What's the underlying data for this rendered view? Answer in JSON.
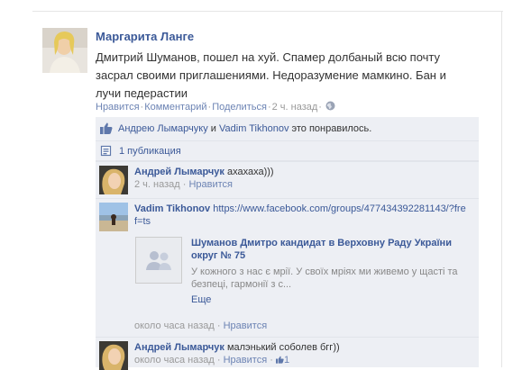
{
  "post": {
    "author": "Маргарита Ланге",
    "text": "Дмитрий Шуманов, пошел на хуй. Спамер долбаный всю почту засрал своими приглашениями. Недоразумение мамкино. Бан и лучи педерастии",
    "actions": {
      "like": "Нравится",
      "comment": "Комментарий",
      "share": "Поделиться",
      "time": "2 ч. назад"
    }
  },
  "likes": {
    "user1": "Андрею Лымарчуку",
    "conj": " и ",
    "user2": "Vadim Tikhonov",
    "suffix": " это понравилось."
  },
  "shares": {
    "label": "1 публикация"
  },
  "comments": [
    {
      "author": "Андрей Лымарчук",
      "text": " ахахаха)))",
      "time": "2 ч. назад",
      "like": "Нравится"
    },
    {
      "author": "Vadim Tikhonov",
      "link_text": " https://www.facebook.com/groups/477434392281143/?fref=ts",
      "preview": {
        "title": "Шуманов Дмитро кандидат в Верховну Раду України округ № 75",
        "desc": "У кожного з нас є мрії. У своїх мріях ми живемо у щасті та безпеці, гармонії з с...",
        "more": "Еще"
      },
      "time": "около часа назад",
      "like": "Нравится"
    },
    {
      "author": "Андрей Лымарчук",
      "text": " малэнький соболев бгг))",
      "time": "около часа назад",
      "like": "Нравится",
      "like_count": "1"
    }
  ],
  "colors": {
    "link": "#3b5998",
    "panel": "#edeff4",
    "meta": "#999999"
  }
}
